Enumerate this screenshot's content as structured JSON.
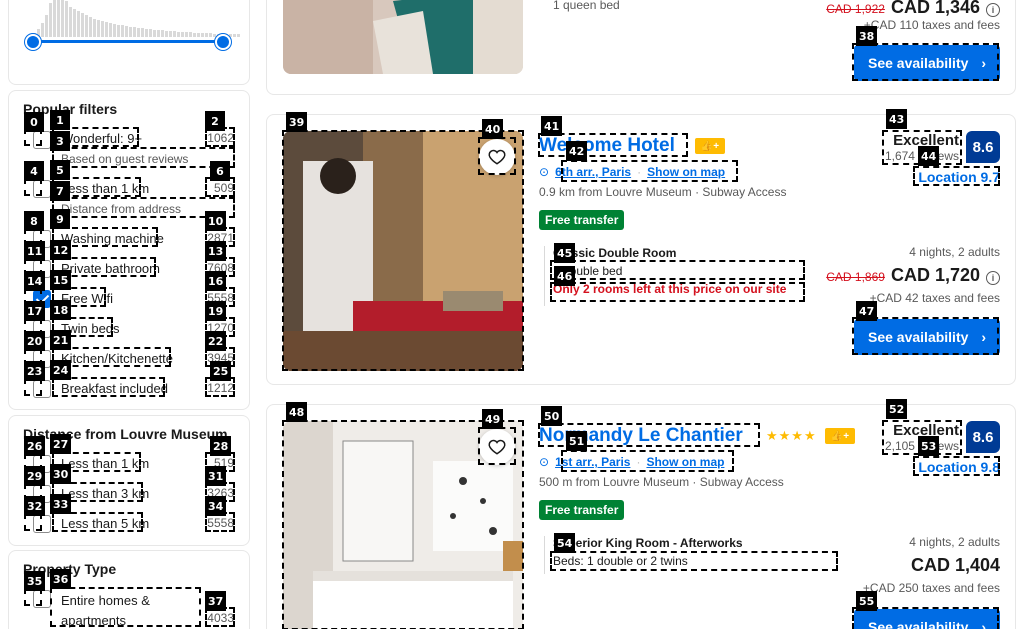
{
  "popular_filters": {
    "title": "Popular filters",
    "items": [
      {
        "label": "Wonderful: 9+",
        "sub": "Based on guest reviews",
        "count": "1062",
        "checked": false
      },
      {
        "label": "Less than 1 km",
        "sub": "Distance from address",
        "count": "509",
        "checked": false
      },
      {
        "label": "Washing machine",
        "count": "2871",
        "checked": false
      },
      {
        "label": "Private bathroom",
        "count": "7608",
        "checked": false
      },
      {
        "label": "Free Wifi",
        "count": "5558",
        "checked": true
      },
      {
        "label": "Twin beds",
        "count": "1270",
        "checked": false
      },
      {
        "label": "Kitchen/Kitchenette",
        "count": "3945",
        "checked": false
      },
      {
        "label": "Breakfast included",
        "count": "1212",
        "checked": false
      }
    ]
  },
  "distance_filters": {
    "title": "Distance from Louvre Museum",
    "items": [
      {
        "label": "Less than 1 km",
        "count": "519"
      },
      {
        "label": "Less than 3 km",
        "count": "3263"
      },
      {
        "label": "Less than 5 km",
        "count": "5558"
      }
    ]
  },
  "property_type": {
    "title": "Property Type",
    "items": [
      {
        "label": "Entire homes & apartments",
        "count": "4033"
      }
    ]
  },
  "top_card": {
    "bed": "1 queen bed",
    "old_price": "CAD 1,922",
    "price": "CAD 1,346",
    "taxes": "+CAD 110 taxes and fees",
    "button": "See availability"
  },
  "hotels": [
    {
      "name": "Welcome Hotel",
      "stars": "",
      "district": "6th arr., Paris",
      "map_link": "Show on map",
      "distance": "0.9 km from Louvre Museum",
      "transit": "Subway Access",
      "tag": "Free transfer",
      "room": "Classic Double Room",
      "bed": "1 double bed",
      "warning": "Only 2 rooms left at this price on our site",
      "review_word": "Excellent",
      "review_count": "1,674 reviews",
      "score": "8.6",
      "location_score": "Location 9.7",
      "nights": "4 nights, 2 adults",
      "old_price": "CAD 1,869",
      "price": "CAD 1,720",
      "taxes": "+CAD 42 taxes and fees",
      "button": "See availability"
    },
    {
      "name": "Normandy Le Chantier",
      "stars": "★★★★",
      "district": "1st arr., Paris",
      "map_link": "Show on map",
      "distance": "500 m from Louvre Museum",
      "transit": "Subway Access",
      "tag": "Free transfer",
      "room": "Superior King Room - Afterworks",
      "bed": "Beds: 1 double or 2 twins",
      "warning": "",
      "review_word": "Excellent",
      "review_count": "2,105 reviews",
      "score": "8.6",
      "location_score": "Location 9.8",
      "nights": "4 nights, 2 adults",
      "old_price": "",
      "price": "CAD 1,404",
      "taxes": "+CAD 250 taxes and fees",
      "button": "See availability"
    }
  ],
  "icons": {
    "heart": "heart-icon",
    "pin": "map-pin-icon",
    "chevron": "chevron-right-icon",
    "thumbs": "thumbs-up-icon"
  },
  "colors": {
    "brand_blue": "#006ce4",
    "score_blue": "#003b95",
    "green": "#008234",
    "red": "#d4111e",
    "gold": "#febb02"
  }
}
